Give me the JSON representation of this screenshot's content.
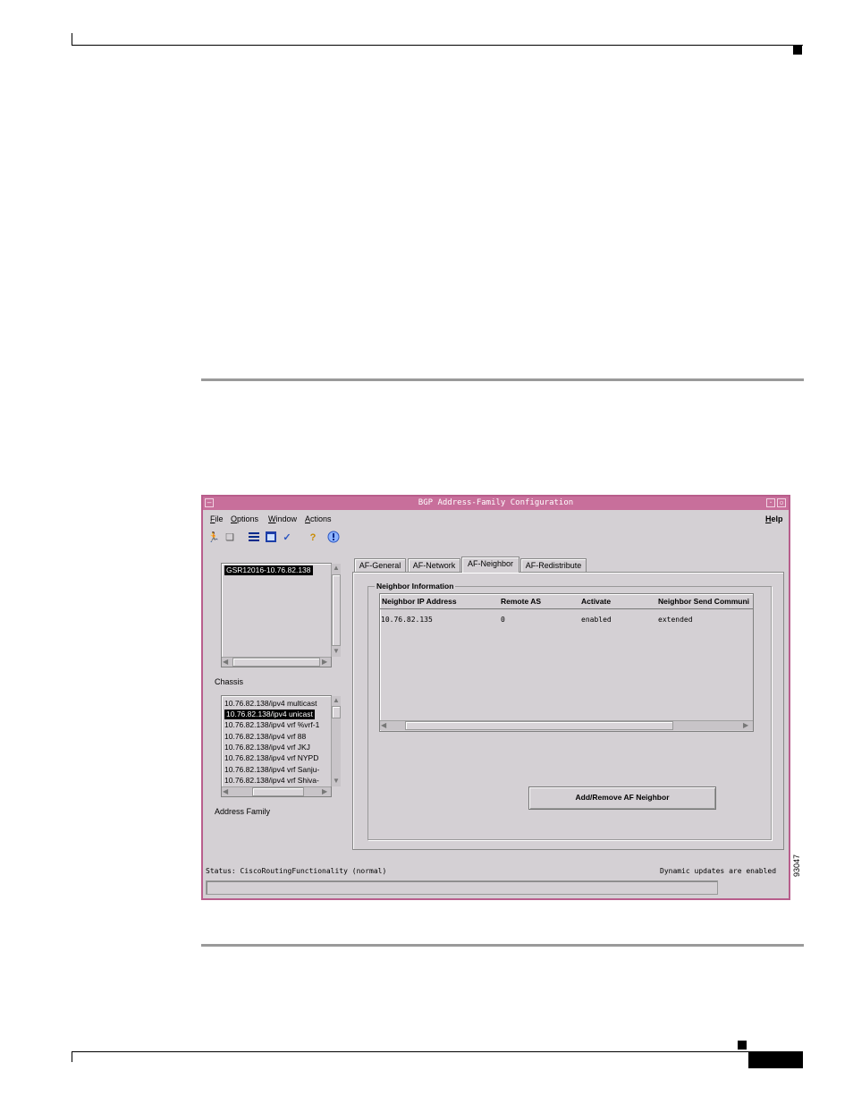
{
  "window": {
    "title": "BGP Address-Family Configuration",
    "minimize_glyph": "–",
    "close_glyph": "▫"
  },
  "menu": {
    "items": [
      {
        "label": "File",
        "key": "F",
        "rest": "ile"
      },
      {
        "label": "Options",
        "key": "O",
        "rest": "ptions"
      },
      {
        "label": "Window",
        "key": "W",
        "rest": "indow"
      },
      {
        "label": "Actions",
        "key": "A",
        "rest": "ctions"
      }
    ],
    "help": {
      "label": "Help",
      "key": "H",
      "rest": "elp"
    }
  },
  "toolbar": {
    "icons": [
      "exit-icon",
      "open-icon",
      "list-icon",
      "window-icon",
      "check-icon",
      "help-icon",
      "info-icon"
    ]
  },
  "chassis": {
    "items": [
      "GSR12016-10.76.82.138"
    ],
    "selected_index": 0,
    "label": "Chassis"
  },
  "address_family": {
    "items": [
      "10.76.82.138/ipv4 multicast",
      "10.76.82.138/ipv4 unicast",
      "10.76.82.138/ipv4 vrf %vrf-1",
      "10.76.82.138/ipv4 vrf 88",
      "10.76.82.138/ipv4 vrf JKJ",
      "10.76.82.138/ipv4 vrf NYPD",
      "10.76.82.138/ipv4 vrf Sanju-",
      "10.76.82.138/ipv4 vrf Shiva-"
    ],
    "selected_index": 1,
    "label": "Address Family"
  },
  "tabs": [
    {
      "label": "AF-General",
      "active": false
    },
    {
      "label": "AF-Network",
      "active": false
    },
    {
      "label": "AF-Neighbor",
      "active": true
    },
    {
      "label": "AF-Redistribute",
      "active": false
    }
  ],
  "neighbor_info": {
    "group_label": "Neighbor Information",
    "columns": [
      "Neighbor IP Address",
      "Remote AS",
      "Activate",
      "Neighbor Send Communi"
    ],
    "rows": [
      [
        "10.76.82.135",
        "0",
        "enabled",
        "extended"
      ]
    ]
  },
  "buttons": {
    "add_remove": "Add/Remove AF Neighbor"
  },
  "status": {
    "left": "Status: CiscoRoutingFunctionality (normal)",
    "right": "Dynamic updates are enabled"
  },
  "figure_id": "93047"
}
